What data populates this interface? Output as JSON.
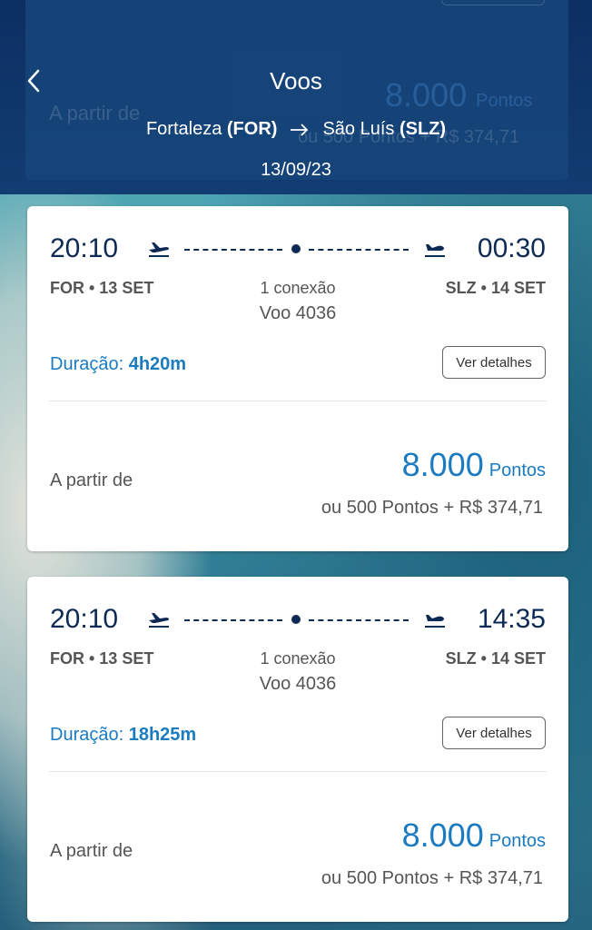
{
  "header": {
    "title": "Voos",
    "origin_city": "Fortaleza",
    "origin_code": "(FOR)",
    "destination_city": "São Luís",
    "destination_code": "(SLZ)",
    "date": "13/09/23"
  },
  "ghost": {
    "from_label": "A partir de",
    "points": "8.000",
    "points_unit": "Pontos",
    "alt": "ou 500 Pontos + R$ 374,71"
  },
  "flights": [
    {
      "departure_time": "20:10",
      "arrival_time": "00:30",
      "departure_info": "FOR • 13 SET",
      "arrival_info": "SLZ • 14 SET",
      "connections": "1 conexão",
      "flight_number": "Voo 4036",
      "duration_label": "Duração:",
      "duration_value": "4h20m",
      "details_label": "Ver detalhes",
      "from_label": "A partir de",
      "points": "8.000",
      "points_unit": "Pontos",
      "alt_price": "ou 500 Pontos + R$ 374,71"
    },
    {
      "departure_time": "20:10",
      "arrival_time": "14:35",
      "departure_info": "FOR • 13 SET",
      "arrival_info": "SLZ • 14 SET",
      "connections": "1 conexão",
      "flight_number": "Voo 4036",
      "duration_label": "Duração:",
      "duration_value": "18h25m",
      "details_label": "Ver detalhes",
      "from_label": "A partir de",
      "points": "8.000",
      "points_unit": "Pontos",
      "alt_price": "ou 500 Pontos + R$ 374,71"
    }
  ],
  "icons": {
    "back": "chevron-left-icon",
    "route_arrow": "arrow-right-icon",
    "departure": "plane-takeoff-icon",
    "arrival": "plane-landing-icon"
  },
  "colors": {
    "header_bg": "#0c2f63",
    "accent": "#1a7bc0",
    "dark_text": "#0d2a55"
  }
}
